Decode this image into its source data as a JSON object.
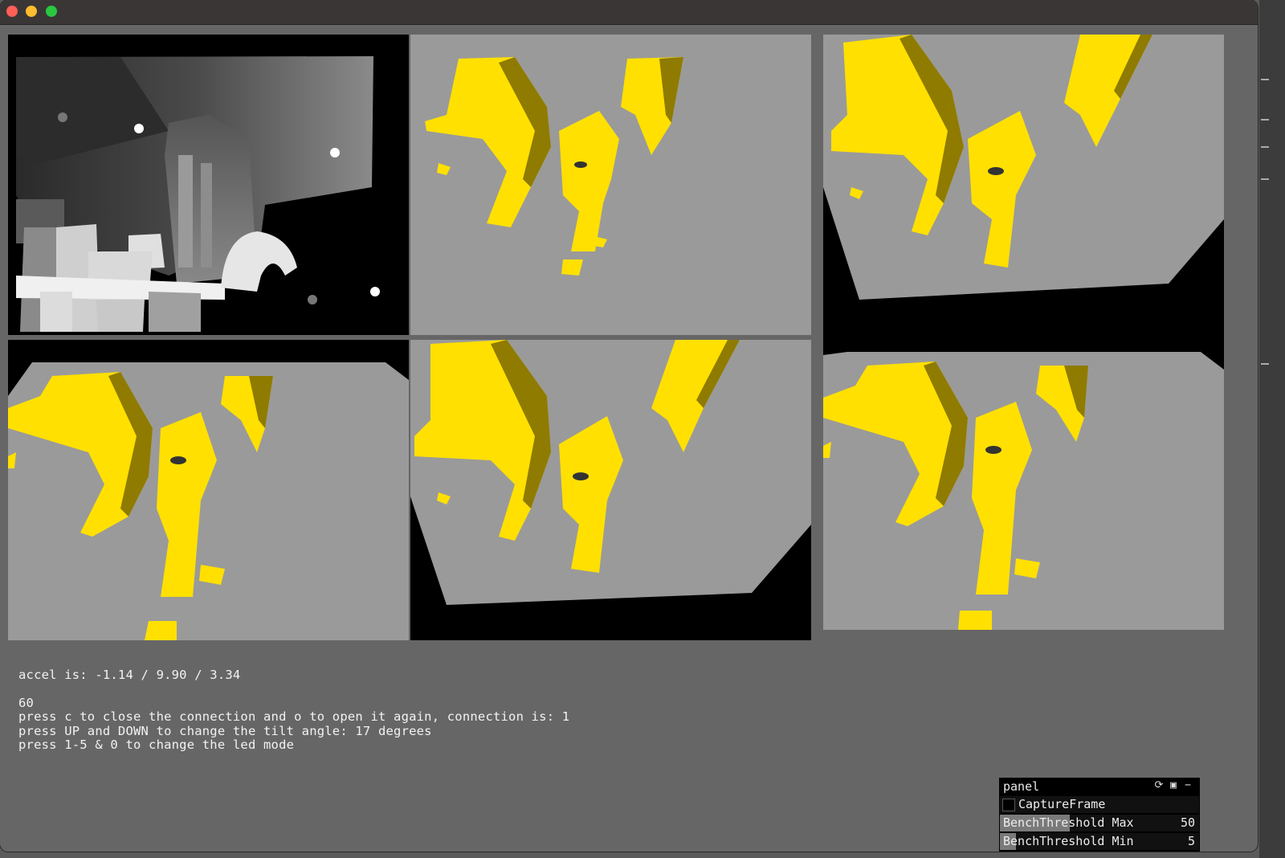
{
  "info": {
    "accel": "accel is: -1.14 / 9.90 / 3.34",
    "framerate": "60",
    "line_connection": "press c to close the connection and o to open it again, connection is: 1",
    "line_tilt": "press UP and DOWN to change the tilt angle: 17 degrees",
    "line_led": "press 1-5 & 0 to change the led mode"
  },
  "panel": {
    "title": "panel",
    "reload_icon": "refresh-icon",
    "save_icon": "save-icon",
    "minimize_icon": "minimize-icon",
    "capture_frame": {
      "label": "CaptureFrame",
      "checked": false
    },
    "bench_max": {
      "label": "BenchThreshold Max",
      "value": "50",
      "fraction": 0.35
    },
    "bench_min": {
      "label": "BenchThreshold Min",
      "value": "5",
      "fraction": 0.08
    }
  },
  "colors": {
    "window_bg": "#666666",
    "view_gray": "#9a9a9a",
    "yellow": "#ffe000",
    "black": "#000000"
  }
}
